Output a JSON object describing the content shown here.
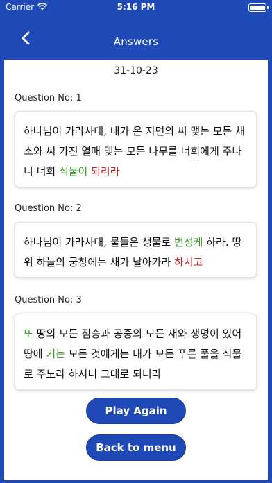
{
  "status_bar": {
    "carrier": "Carrier",
    "time": "5:16 PM"
  },
  "nav": {
    "title": "Answers",
    "back_icon": "chevron-left-icon"
  },
  "date": "31-10-23",
  "questions": [
    {
      "label": "Question No: 1",
      "segments": [
        {
          "text": "하나님이 가라사대, 내가 온 지면의 씨 맺는 모든 채소와 씨 가진 열매 맺는 모든 나무를 너희에게 주나니 너희 ",
          "style": "normal"
        },
        {
          "text": "식물이",
          "style": "correct"
        },
        {
          "text": " ",
          "style": "normal"
        },
        {
          "text": "되리라",
          "style": "wrong"
        }
      ]
    },
    {
      "label": "Question No: 2",
      "segments": [
        {
          "text": "하나님이 가라사대, 물들은 생물로 ",
          "style": "normal"
        },
        {
          "text": "번성케",
          "style": "correct"
        },
        {
          "text": " 하라. 땅위 하늘의 궁창에는 새가 날아가라 ",
          "style": "normal"
        },
        {
          "text": "하시고",
          "style": "wrong"
        }
      ]
    },
    {
      "label": "Question No: 3",
      "segments": [
        {
          "text": "또",
          "style": "correct"
        },
        {
          "text": " 땅의 모든 짐승과 공중의 모든 새와 생명이 있어 땅에 ",
          "style": "normal"
        },
        {
          "text": "기는",
          "style": "correct"
        },
        {
          "text": " 모든 것에게는 내가 모든 푸른 풀을 식물로 주노라 하시니 그대로 되니라",
          "style": "normal"
        }
      ]
    }
  ],
  "buttons": {
    "play_again": "Play Again",
    "back_to_menu": "Back to menu"
  },
  "colors": {
    "primary": "#1f49b6",
    "correct": "#3d9a2b",
    "wrong": "#d41f1f"
  }
}
